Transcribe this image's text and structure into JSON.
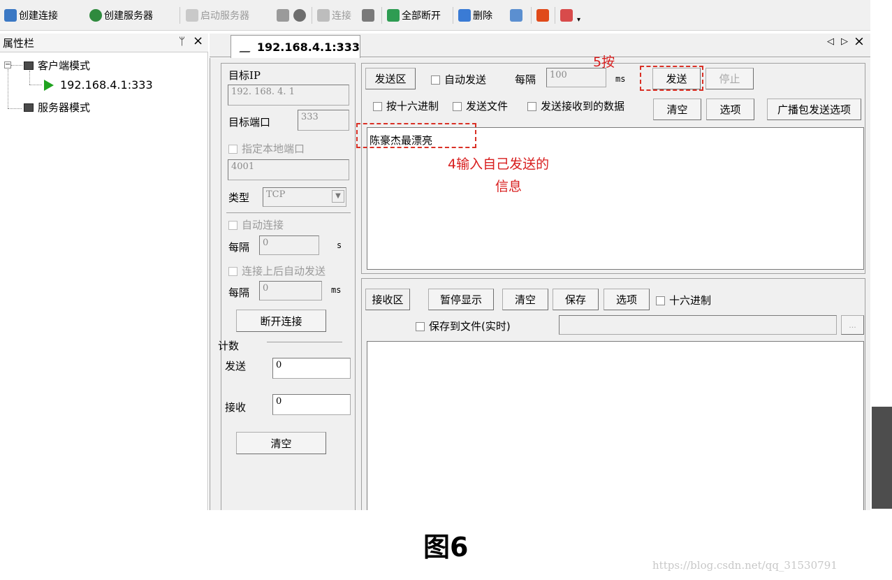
{
  "toolbar": {
    "create_connection": "创建连接",
    "create_server": "创建服务器",
    "start_server": "启动服务器",
    "connect": "连接",
    "disconnect_all": "全部断开",
    "delete": "删除"
  },
  "sidebar": {
    "title": "属性栏",
    "pin": "ᛘ",
    "close": "×",
    "tree": [
      "客户端模式",
      "192.168.4.1:333",
      "服务器模式"
    ]
  },
  "tab": {
    "label": "192.168.4.1:333",
    "nav_left": "◁",
    "nav_right": "▷",
    "close": "×"
  },
  "conn": {
    "target_ip_label": "目标IP",
    "target_ip": "192. 168. 4. 1",
    "target_port_label": "目标端口",
    "target_port": "333",
    "local_port_label": "指定本地端口",
    "local_port": "4001",
    "type_label": "类型",
    "type_value": "TCP",
    "auto_connect_label": "自动连接",
    "interval_label": "每隔",
    "interval1": "0",
    "unit_s": "s",
    "auto_send_after_label": "连接上后自动发送",
    "interval2": "0",
    "unit_ms": "ms",
    "disconnect_button": "断开连接"
  },
  "counter": {
    "title": "计数",
    "send_label": "发送",
    "send_value": "0",
    "recv_label": "接收",
    "recv_value": "0",
    "clear_button": "清空"
  },
  "send": {
    "area_label": "发送区",
    "auto_send_label": "自动发送",
    "interval_label": "每隔",
    "interval_value": "100",
    "unit": "ms",
    "send_button": "发送",
    "stop_button": "停止",
    "hex_label": "按十六进制",
    "send_file_label": "发送文件",
    "send_received_label": "发送接收到的数据",
    "clear_button": "清空",
    "options_button": "选项",
    "broadcast_button": "广播包发送选项",
    "text": "陈豪杰最漂亮"
  },
  "receive": {
    "area_label": "接收区",
    "pause_button": "暂停显示",
    "clear_button": "清空",
    "save_button": "保存",
    "options_button": "选项",
    "hex_label": "十六进制",
    "save_file_label": "保存到文件(实时)",
    "browse_button": "..."
  },
  "annotations": {
    "step5": "5按",
    "step4_line1": "4输入自己发送的",
    "step4_line2": "信息"
  },
  "caption": {
    "figure": "图6",
    "watermark": "https://blog.csdn.net/qq_31530791"
  },
  "colors": {
    "annotation": "#d81e1e",
    "play": "#1fa31f"
  }
}
